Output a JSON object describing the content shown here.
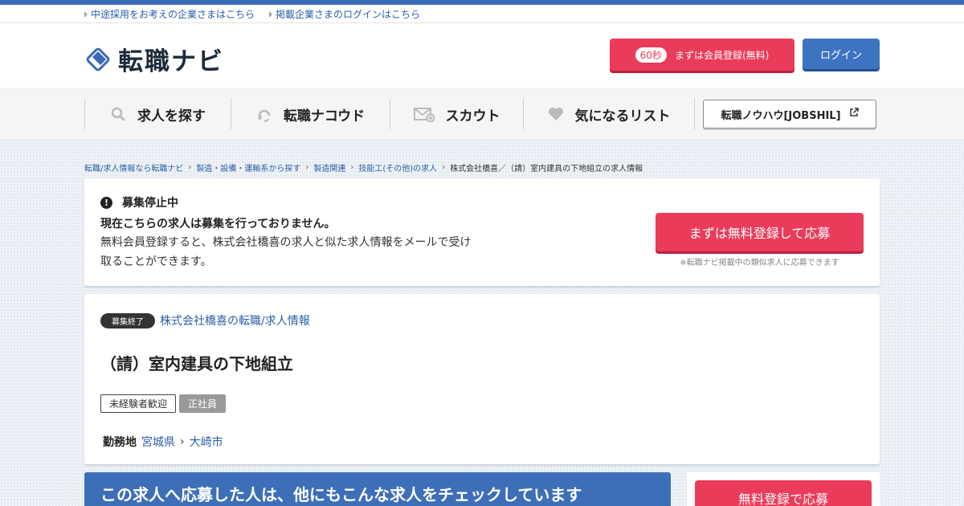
{
  "util_links": [
    "中途採用をお考えの企業さまはこちら",
    "掲載企業さまのログインはこちら"
  ],
  "header": {
    "logo_text": "転職ナビ",
    "register_badge": "60秒",
    "register_label": "まずは会員登録(無料)",
    "login_label": "ログイン"
  },
  "nav": {
    "items": [
      {
        "label": "求人を探す",
        "icon": "search-icon"
      },
      {
        "label": "転職ナコウド",
        "icon": "headset-icon"
      },
      {
        "label": "スカウト",
        "icon": "mail-plus-icon"
      },
      {
        "label": "気になるリスト",
        "icon": "heart-icon"
      }
    ],
    "knowhow_label": "転職ノウハウ[JOBSHIL]"
  },
  "breadcrumb": {
    "items": [
      "転職/求人情報なら転職ナビ",
      "製造・設備・運輸系から探す",
      "製造関連",
      "技能工(その他)の求人"
    ],
    "current": "株式会社橋喜／（請）室内建具の下地組立の求人情報"
  },
  "closed_notice": {
    "heading": "募集停止中",
    "strong": "現在こちらの求人は募集を行っておりません。",
    "desc": "無料会員登録すると、株式会社橋喜の求人と似た求人情報をメールで受け取ることができます。",
    "apply_label": "まずは無料登録して応募",
    "apply_note": "※転職ナビ掲載中の類似求人に応募できます"
  },
  "job": {
    "status_badge": "募集終了",
    "company_link": "株式会社橋喜の転職/求人情報",
    "title": "（請）室内建具の下地組立",
    "tags": [
      "未経験者歓迎",
      "正社員"
    ],
    "location_label": "勤務地",
    "prefecture": "宮城県",
    "city": "大崎市"
  },
  "related": {
    "heading": "この求人へ応募した人は、他にもこんな求人をチェックしています",
    "side_apply_label": "無料登録で応募"
  },
  "colors": {
    "brand_blue": "#3a6ab8",
    "accent_red": "#eb3b5a",
    "link_blue": "#2b5ea7"
  }
}
